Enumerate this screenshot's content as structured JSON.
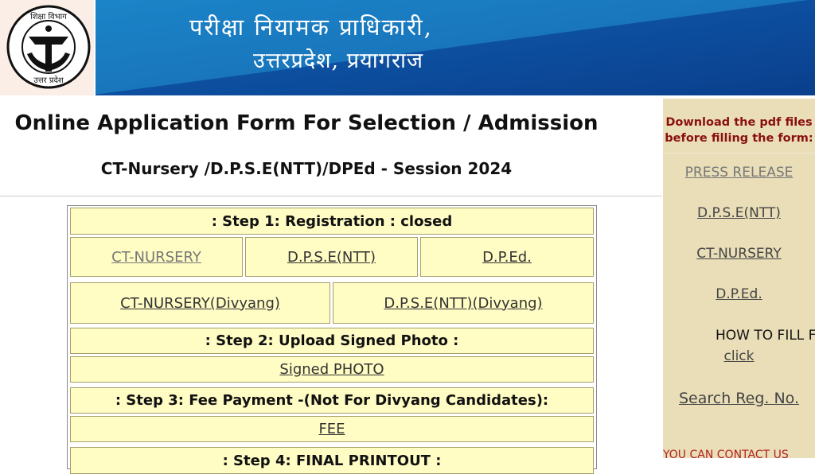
{
  "header": {
    "logo_text_top": "शिक्षा विभाग",
    "logo_text_bottom": "उत्तर प्रदेश",
    "banner_line1": "परीक्षा  नियामक  प्राधिकारी,",
    "banner_line2": "उत्तरप्रदेश, प्रयागराज",
    "colors": {
      "banner_light": "#1b84c8",
      "banner_dark": "#0a3f8c"
    }
  },
  "main": {
    "title": "Online Application Form For Selection / Admission",
    "subtitle": "CT-Nursery /D.P.S.E(NTT)/DPEd - Session 2024"
  },
  "form": {
    "step1_header": ": Step 1: Registration : closed",
    "step1_links": [
      "CT-NURSERY",
      "D.P.S.E(NTT)",
      "D.P.Ed."
    ],
    "step1_divyang_links": [
      "CT-NURSERY(Divyang)",
      "D.P.S.E(NTT)(Divyang)"
    ],
    "step2_header": ": Step 2: Upload Signed Photo :",
    "step2_link": "Signed PHOTO",
    "step3_header": ": Step 3: Fee Payment -(Not For Divyang Candidates):",
    "step3_link": "FEE",
    "step4_header": ": Step 4: FINAL PRINTOUT :"
  },
  "sidebar": {
    "note": "Download the pdf files before filling the form:",
    "links": [
      "PRESS RELEASE",
      "D.P.S.E(NTT)",
      "CT-NURSERY",
      "D.P.Ed."
    ],
    "how_to_fill": "HOW TO FILL F",
    "click": "click",
    "search": "Search Reg. No.",
    "contact": "YOU CAN CONTACT US"
  }
}
